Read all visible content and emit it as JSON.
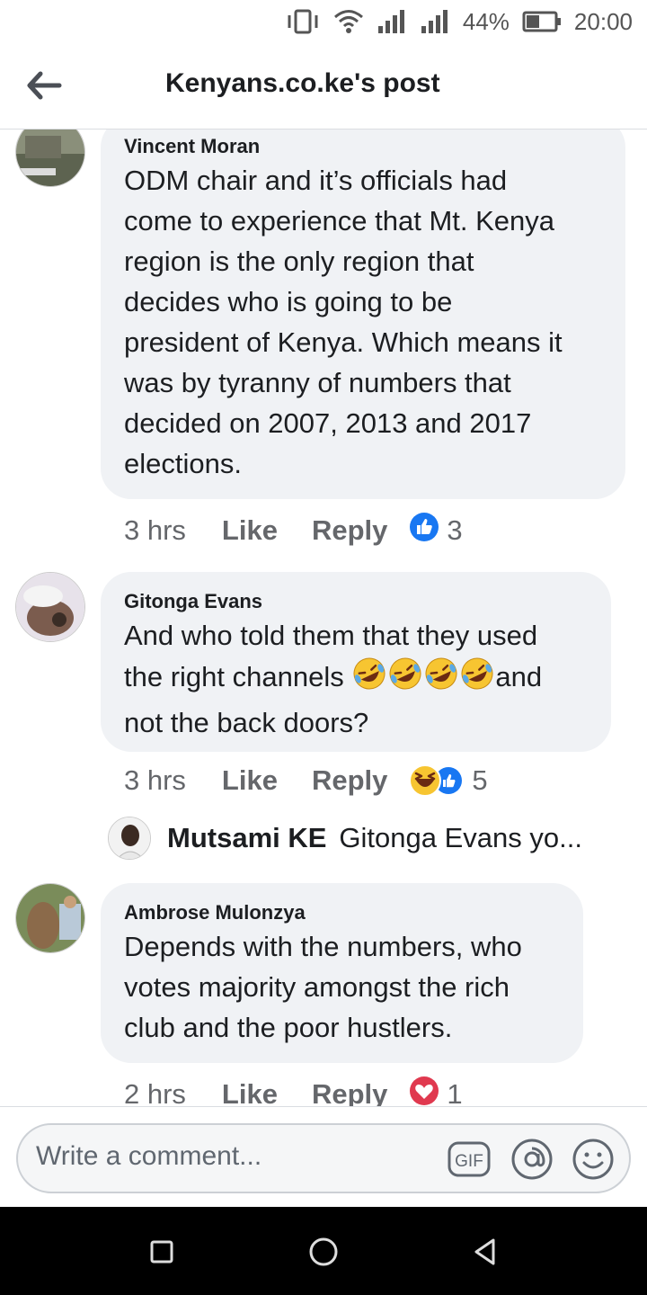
{
  "status_bar": {
    "battery": "44%",
    "time": "20:00"
  },
  "header": {
    "title": "Kenyans.co.ke's post"
  },
  "comments": [
    {
      "author": "Vincent Moran",
      "lines": [
        "ODM chair and it’s officials  had",
        "come to experience that Mt. Kenya",
        "region is the only region that",
        "decides who is going to be",
        "president of Kenya. Which means it",
        "was by tyranny of numbers that",
        "decided on 2007, 2013 and 2017",
        "elections."
      ],
      "time": "3 hrs",
      "like_label": "Like",
      "reply_label": "Reply",
      "reaction_count": "3"
    },
    {
      "author": "Gitonga Evans",
      "line1": "And who told them that they used",
      "line2_pre": "the right channels",
      "line2_post": "and",
      "line3": "not the back doors?",
      "time": "3 hrs",
      "like_label": "Like",
      "reply_label": "Reply",
      "reaction_count": "5"
    },
    {
      "author": "Ambrose Mulonzya",
      "lines": [
        "Depends with the numbers, who",
        "votes majority amongst the rich",
        "club and the poor hustlers."
      ],
      "time": "2 hrs",
      "like_label": "Like",
      "reply_label": "Reply",
      "reaction_count": "1"
    }
  ],
  "reply_preview": {
    "author": "Mutsami KE",
    "text": "Gitonga Evans yo..."
  },
  "composer": {
    "placeholder": "Write a comment...",
    "gif_label": "GIF"
  },
  "icons": {
    "back": "arrow-left-icon",
    "gif": "gif-icon",
    "mention": "at-icon",
    "emoji": "smiley-icon",
    "like_reaction": "like-reaction-icon",
    "haha_reaction": "haha-reaction-icon",
    "love_reaction": "love-reaction-icon"
  },
  "colors": {
    "like_blue": "#1877f2",
    "love_red": "#e0394f",
    "bubble": "#f0f2f5",
    "text_secondary": "#65676b"
  }
}
